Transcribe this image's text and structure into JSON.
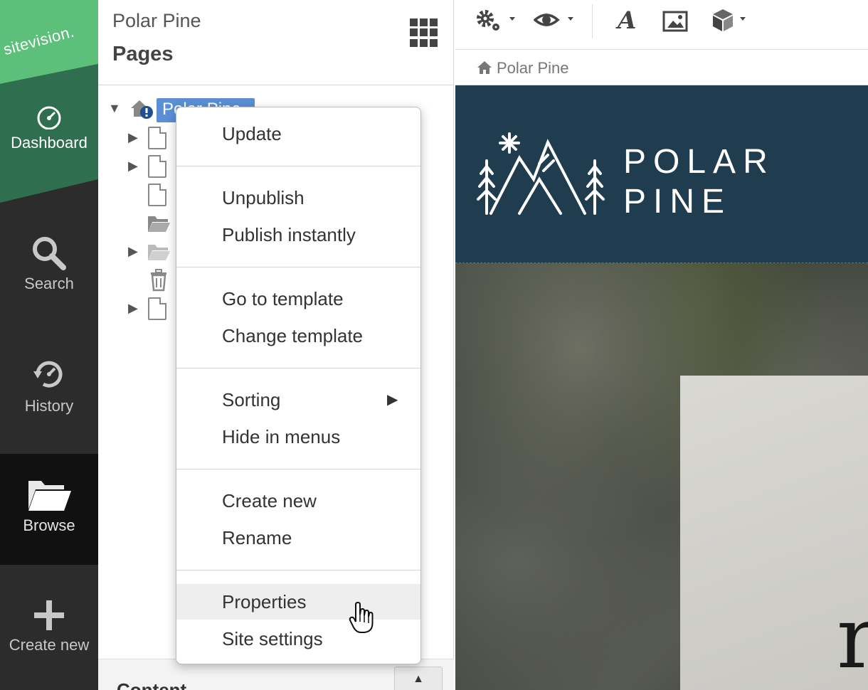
{
  "sidebar": {
    "brand": "sitevision.",
    "items": [
      {
        "label": "Dashboard",
        "icon": "dashboard-gauge-icon"
      },
      {
        "label": "Search",
        "icon": "search-icon"
      },
      {
        "label": "History",
        "icon": "history-clock-icon"
      },
      {
        "label": "Browse",
        "icon": "folder-open-icon"
      },
      {
        "label": "Create new",
        "icon": "plus-icon"
      }
    ],
    "colors": {
      "green_light": "#5cbf7a",
      "green_dark": "#2f6e4e",
      "dark": "#2c2c2c",
      "active": "#111111"
    }
  },
  "panel": {
    "site_name": "Polar Pine",
    "title": "Pages",
    "tree_root": "Polar Pine",
    "content_label": "Content"
  },
  "toolbar": {
    "buttons": [
      "settings-gears-icon",
      "view-eye-icon",
      "text-format-icon",
      "image-icon",
      "module-cube-icon"
    ]
  },
  "breadcrumb": {
    "home": "Polar Pine"
  },
  "hero": {
    "logo_line1": "POLAR",
    "logo_line2": "PINE",
    "bg": "#1f3d4f"
  },
  "menu": {
    "items": [
      {
        "label": "Update"
      },
      {
        "label": "Unpublish"
      },
      {
        "label": "Publish instantly"
      },
      {
        "label": "Go to template"
      },
      {
        "label": "Change template"
      },
      {
        "label": "Sorting",
        "submenu": true
      },
      {
        "label": "Hide in menus"
      },
      {
        "label": "Create new"
      },
      {
        "label": "Rename"
      },
      {
        "label": "Properties",
        "highlighted": true
      },
      {
        "label": "Site settings"
      }
    ]
  },
  "page_card_letter": "r"
}
